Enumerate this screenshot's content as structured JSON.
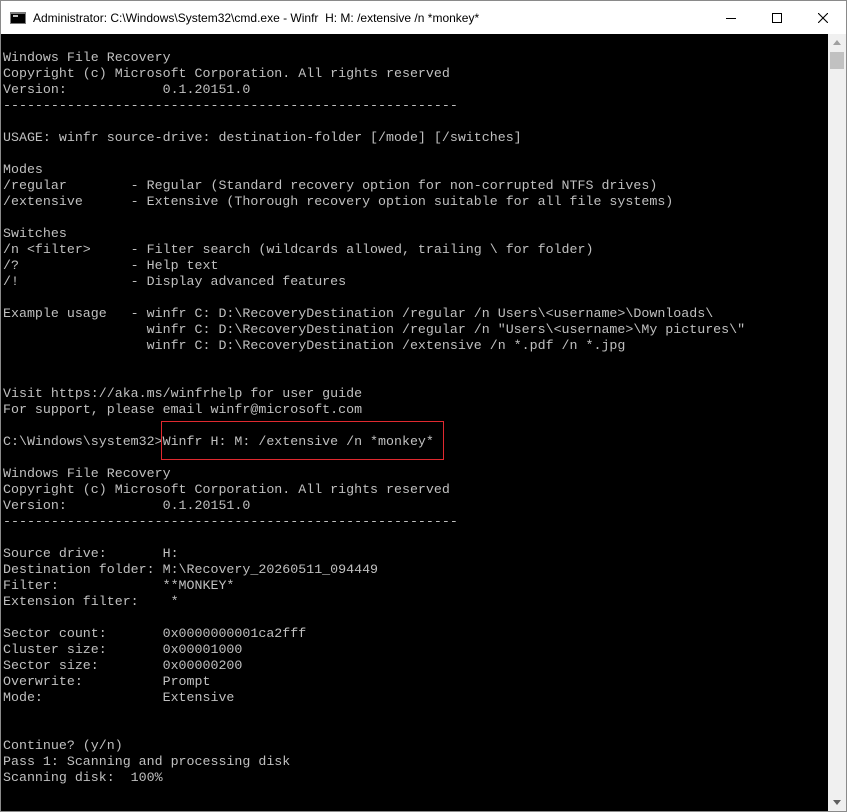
{
  "window": {
    "title": "Administrator: C:\\Windows\\System32\\cmd.exe - Winfr  H: M: /extensive /n *monkey*",
    "icon": "cmd-console-icon",
    "controls": {
      "minimize": "minimize-icon",
      "maximize": "maximize-icon",
      "close": "close-icon"
    }
  },
  "console": {
    "text_color": "#c0c0c0",
    "background": "#000000",
    "highlight_color": "#e0292f",
    "lines": [
      "Windows File Recovery",
      "Copyright (c) Microsoft Corporation. All rights reserved",
      "Version:            0.1.20151.0",
      "---------------------------------------------------------",
      "",
      "USAGE: winfr source-drive: destination-folder [/mode] [/switches]",
      "",
      "Modes",
      "/regular        - Regular (Standard recovery option for non-corrupted NTFS drives)",
      "/extensive      - Extensive (Thorough recovery option suitable for all file systems)",
      "",
      "Switches",
      "/n <filter>     - Filter search (wildcards allowed, trailing \\ for folder)",
      "/?              - Help text",
      "/!              - Display advanced features",
      "",
      "Example usage   - winfr C: D:\\RecoveryDestination /regular /n Users\\<username>\\Downloads\\",
      "                  winfr C: D:\\RecoveryDestination /regular /n \"Users\\<username>\\My pictures\\\"",
      "                  winfr C: D:\\RecoveryDestination /extensive /n *.pdf /n *.jpg",
      "",
      "",
      "Visit https://aka.ms/winfrhelp for user guide",
      "For support, please email winfr@microsoft.com",
      "",
      "C:\\Windows\\system32>Winfr H: M: /extensive /n *monkey*",
      "",
      "Windows File Recovery",
      "Copyright (c) Microsoft Corporation. All rights reserved",
      "Version:            0.1.20151.0",
      "---------------------------------------------------------",
      "",
      "Source drive:       H:",
      "Destination folder: M:\\Recovery_20260511_094449",
      "Filter:             **MONKEY*",
      "Extension filter:    *",
      "",
      "Sector count:       0x0000000001ca2fff",
      "Cluster size:       0x00001000",
      "Sector size:        0x00000200",
      "Overwrite:          Prompt",
      "Mode:               Extensive",
      "",
      "",
      "Continue? (y/n)",
      "Pass 1: Scanning and processing disk",
      "Scanning disk:  100%"
    ]
  },
  "scrollbar": {
    "up": "scroll-up-arrow-icon",
    "down": "scroll-down-arrow-icon"
  }
}
